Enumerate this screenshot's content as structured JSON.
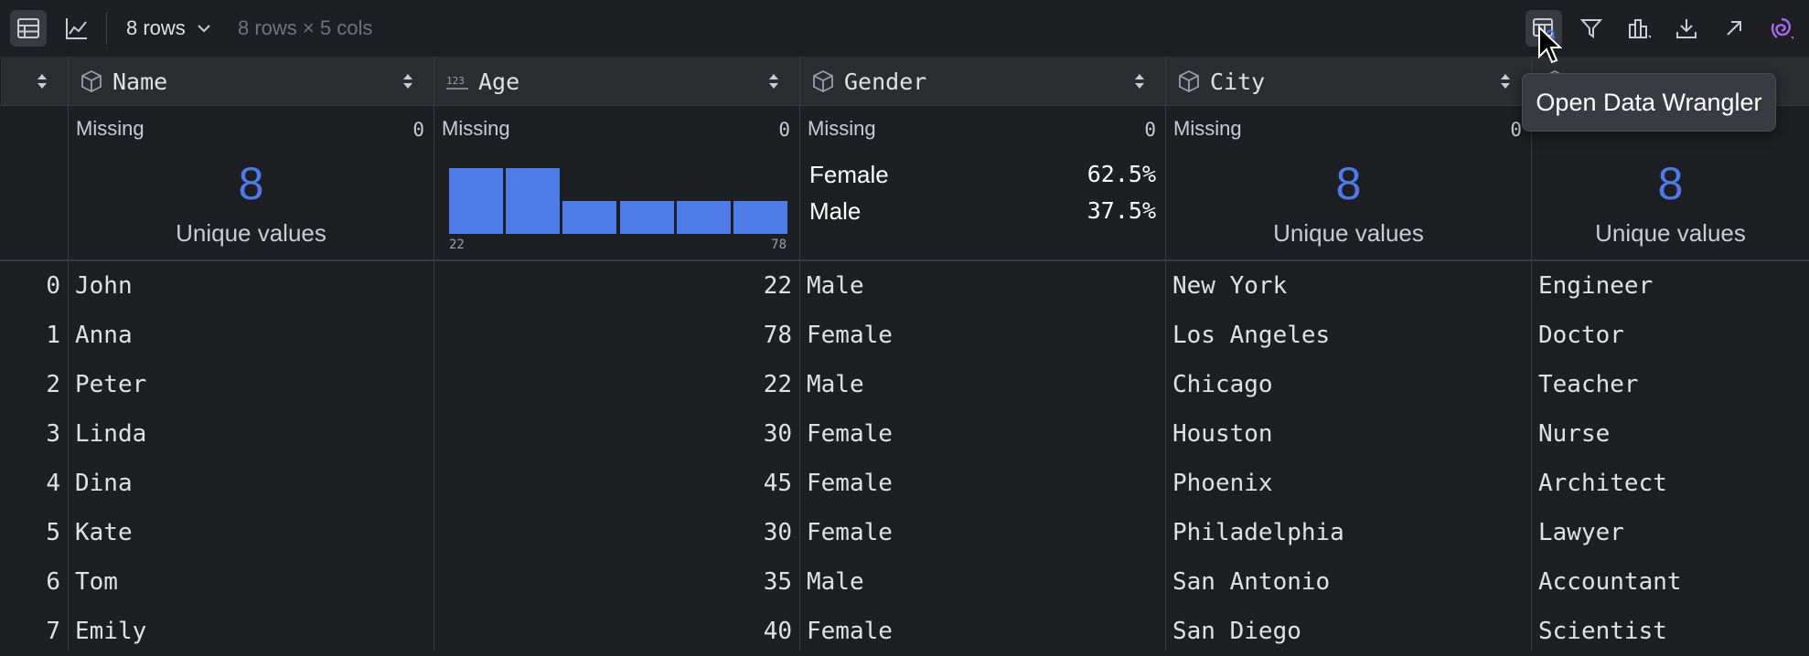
{
  "toolbar": {
    "table_view_icon": "table-icon",
    "chart_view_icon": "line-chart-icon",
    "rows_label": "8 rows",
    "shape_info": "8 rows × 5 cols",
    "right_icons": [
      "open-data-wrangler-icon",
      "filter-icon",
      "column-chart-icon",
      "download-icon",
      "open-external-icon",
      "copilot-swirl-icon"
    ]
  },
  "columns": [
    {
      "name": "Name",
      "type_icon": "cube-icon"
    },
    {
      "name": "Age",
      "type_icon": "numeric-123-icon"
    },
    {
      "name": "Gender",
      "type_icon": "cube-icon"
    },
    {
      "name": "City",
      "type_icon": "cube-icon"
    },
    {
      "name": "",
      "type_icon": "cube-icon"
    }
  ],
  "summary": {
    "missing_label": "Missing",
    "name": {
      "missing": "0",
      "unique": "8",
      "unique_label": "Unique values"
    },
    "age": {
      "missing": "0",
      "hist_min": "22",
      "hist_max": "78",
      "hist_bins": [
        2,
        2,
        1,
        1,
        1,
        1
      ]
    },
    "gender": {
      "missing": "0",
      "values": [
        {
          "label": "Female",
          "pct": "62.5%"
        },
        {
          "label": "Male",
          "pct": "37.5%"
        }
      ]
    },
    "city": {
      "missing": "0",
      "unique": "8",
      "unique_label": "Unique values"
    },
    "occupation": {
      "unique": "8",
      "unique_label": "Unique values"
    }
  },
  "rows": [
    {
      "idx": "0",
      "name": "John",
      "age": "22",
      "gender": "Male",
      "city": "New York",
      "occupation": "Engineer"
    },
    {
      "idx": "1",
      "name": "Anna",
      "age": "78",
      "gender": "Female",
      "city": "Los Angeles",
      "occupation": "Doctor"
    },
    {
      "idx": "2",
      "name": "Peter",
      "age": "22",
      "gender": "Male",
      "city": "Chicago",
      "occupation": "Teacher"
    },
    {
      "idx": "3",
      "name": "Linda",
      "age": "30",
      "gender": "Female",
      "city": "Houston",
      "occupation": "Nurse"
    },
    {
      "idx": "4",
      "name": "Dina",
      "age": "45",
      "gender": "Female",
      "city": "Phoenix",
      "occupation": "Architect"
    },
    {
      "idx": "5",
      "name": "Kate",
      "age": "30",
      "gender": "Female",
      "city": "Philadelphia",
      "occupation": "Lawyer"
    },
    {
      "idx": "6",
      "name": "Tom",
      "age": "35",
      "gender": "Male",
      "city": "San Antonio",
      "occupation": "Accountant"
    },
    {
      "idx": "7",
      "name": "Emily",
      "age": "40",
      "gender": "Female",
      "city": "San Diego",
      "occupation": "Scientist"
    }
  ],
  "tooltip": {
    "text": "Open Data Wrangler"
  },
  "colors": {
    "accent": "#4d7ce8",
    "background": "#1e1f22",
    "header": "#2b2d30"
  }
}
